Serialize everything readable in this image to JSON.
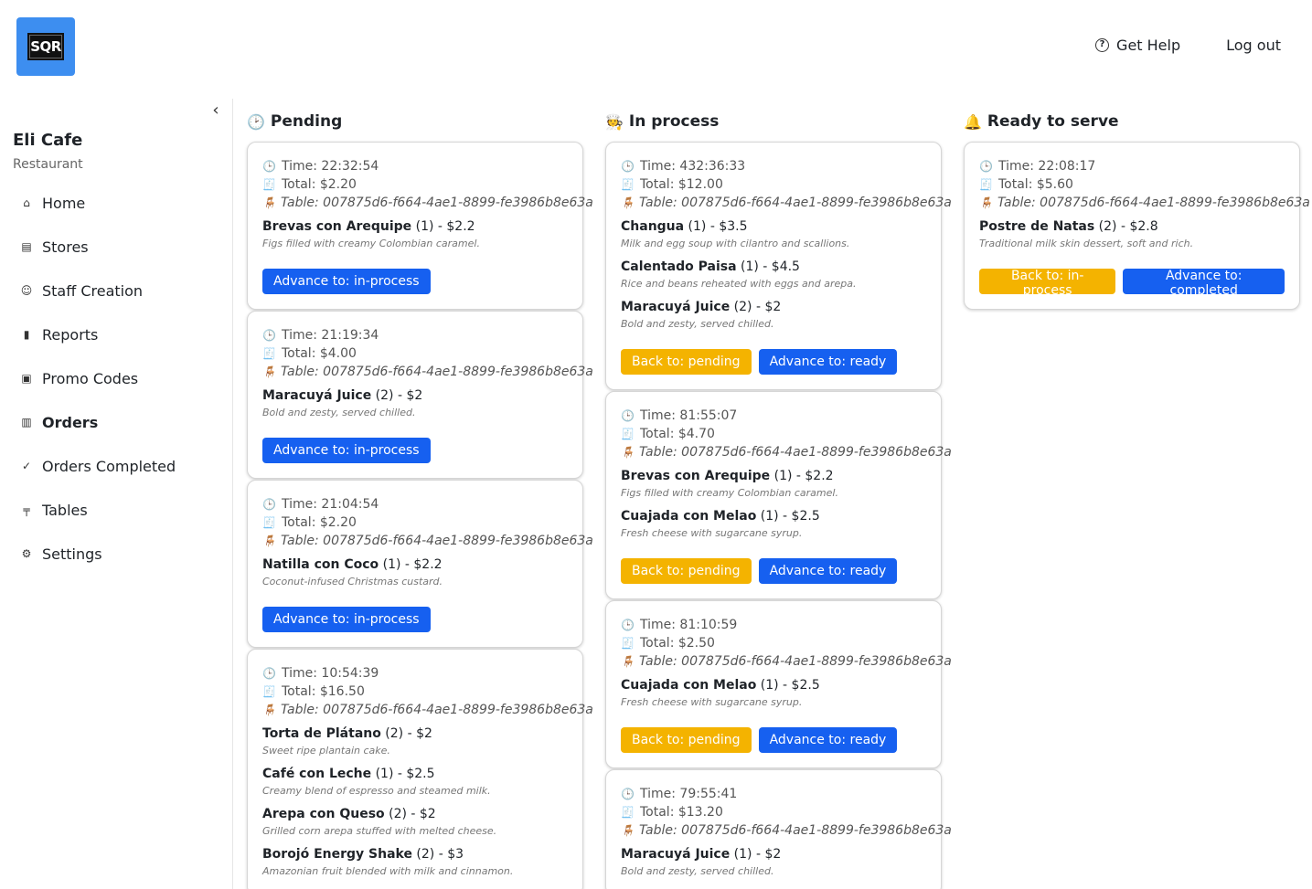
{
  "header": {
    "logo_text": "SQR",
    "help_label": "Get Help",
    "logout_label": "Log out"
  },
  "store": {
    "name": "Eli Cafe",
    "type": "Restaurant"
  },
  "menu": [
    {
      "label": "Home",
      "icon": "home-icon",
      "glyph": "⌂"
    },
    {
      "label": "Stores",
      "icon": "store-icon",
      "glyph": "▤"
    },
    {
      "label": "Staff Creation",
      "icon": "staff-icon",
      "glyph": "☺"
    },
    {
      "label": "Reports",
      "icon": "chart-icon",
      "glyph": "▮"
    },
    {
      "label": "Promo Codes",
      "icon": "ticket-icon",
      "glyph": "▣"
    },
    {
      "label": "Orders",
      "icon": "orders-icon",
      "glyph": "▥"
    },
    {
      "label": "Orders Completed",
      "icon": "check-circle-icon",
      "glyph": "✓"
    },
    {
      "label": "Tables",
      "icon": "table-icon",
      "glyph": "╤"
    },
    {
      "label": "Settings",
      "icon": "gear-icon",
      "glyph": "⚙"
    }
  ],
  "columns": [
    {
      "title": "Pending",
      "emoji": "🕑",
      "orders": [
        {
          "time": "Time: 22:32:54",
          "total": "Total: $2.20",
          "table": "Table: 007875d6-f664-4ae1-8899-fe3986b8e63a",
          "items": [
            {
              "name": "Brevas con Arequipe",
              "qty": " (1) - $2.2",
              "desc": "Figs filled with creamy Colombian caramel."
            }
          ],
          "buttons": [
            {
              "label": "Advance to: in-process",
              "style": "blue"
            }
          ]
        },
        {
          "time": "Time: 21:19:34",
          "total": "Total: $4.00",
          "table": "Table: 007875d6-f664-4ae1-8899-fe3986b8e63a",
          "items": [
            {
              "name": "Maracuyá Juice",
              "qty": " (2) - $2",
              "desc": "Bold and zesty, served chilled."
            }
          ],
          "buttons": [
            {
              "label": "Advance to: in-process",
              "style": "blue"
            }
          ]
        },
        {
          "time": "Time: 21:04:54",
          "total": "Total: $2.20",
          "table": "Table: 007875d6-f664-4ae1-8899-fe3986b8e63a",
          "items": [
            {
              "name": "Natilla con Coco",
              "qty": " (1) - $2.2",
              "desc": "Coconut-infused Christmas custard."
            }
          ],
          "buttons": [
            {
              "label": "Advance to: in-process",
              "style": "blue"
            }
          ]
        },
        {
          "time": "Time: 10:54:39",
          "total": "Total: $16.50",
          "table": "Table: 007875d6-f664-4ae1-8899-fe3986b8e63a",
          "items": [
            {
              "name": "Torta de Plátano",
              "qty": " (2) - $2",
              "desc": "Sweet ripe plantain cake."
            },
            {
              "name": "Café con Leche",
              "qty": " (1) - $2.5",
              "desc": "Creamy blend of espresso and steamed milk."
            },
            {
              "name": "Arepa con Queso",
              "qty": " (2) - $2",
              "desc": "Grilled corn arepa stuffed with melted cheese."
            },
            {
              "name": "Borojó Energy Shake",
              "qty": " (2) - $3",
              "desc": "Amazonian fruit blended with milk and cinnamon."
            }
          ],
          "buttons": []
        }
      ]
    },
    {
      "title": "In process",
      "emoji": "🧑‍🍳",
      "orders": [
        {
          "time": "Time: 432:36:33",
          "total": "Total: $12.00",
          "table": "Table: 007875d6-f664-4ae1-8899-fe3986b8e63a",
          "items": [
            {
              "name": "Changua",
              "qty": " (1) - $3.5",
              "desc": "Milk and egg soup with cilantro and scallions."
            },
            {
              "name": "Calentado Paisa",
              "qty": " (1) - $4.5",
              "desc": "Rice and beans reheated with eggs and arepa."
            },
            {
              "name": "Maracuyá Juice",
              "qty": " (2) - $2",
              "desc": "Bold and zesty, served chilled."
            }
          ],
          "buttons": [
            {
              "label": "Back to: pending",
              "style": "yellow"
            },
            {
              "label": "Advance to: ready",
              "style": "blue"
            }
          ]
        },
        {
          "time": "Time: 81:55:07",
          "total": "Total: $4.70",
          "table": "Table: 007875d6-f664-4ae1-8899-fe3986b8e63a",
          "items": [
            {
              "name": "Brevas con Arequipe",
              "qty": " (1) - $2.2",
              "desc": "Figs filled with creamy Colombian caramel."
            },
            {
              "name": "Cuajada con Melao",
              "qty": " (1) - $2.5",
              "desc": "Fresh cheese with sugarcane syrup."
            }
          ],
          "buttons": [
            {
              "label": "Back to: pending",
              "style": "yellow"
            },
            {
              "label": "Advance to: ready",
              "style": "blue"
            }
          ]
        },
        {
          "time": "Time: 81:10:59",
          "total": "Total: $2.50",
          "table": "Table: 007875d6-f664-4ae1-8899-fe3986b8e63a",
          "items": [
            {
              "name": "Cuajada con Melao",
              "qty": " (1) - $2.5",
              "desc": "Fresh cheese with sugarcane syrup."
            }
          ],
          "buttons": [
            {
              "label": "Back to: pending",
              "style": "yellow"
            },
            {
              "label": "Advance to: ready",
              "style": "blue"
            }
          ]
        },
        {
          "time": "Time: 79:55:41",
          "total": "Total: $13.20",
          "table": "Table: 007875d6-f664-4ae1-8899-fe3986b8e63a",
          "items": [
            {
              "name": "Maracuyá Juice",
              "qty": " (1) - $2",
              "desc": "Bold and zesty, served chilled."
            }
          ],
          "buttons": []
        }
      ]
    },
    {
      "title": "Ready to serve",
      "emoji": "🔔",
      "orders": [
        {
          "time": "Time: 22:08:17",
          "total": "Total: $5.60",
          "table": "Table: 007875d6-f664-4ae1-8899-fe3986b8e63a",
          "items": [
            {
              "name": "Postre de Natas",
              "qty": " (2) - $2.8",
              "desc": "Traditional milk skin dessert, soft and rich."
            }
          ],
          "buttons": [
            {
              "label": "Back to: in-process",
              "style": "yellow"
            },
            {
              "label": "Advance to: completed",
              "style": "blue"
            }
          ]
        }
      ]
    }
  ],
  "icons": {
    "time": "🕒",
    "total": "🧾",
    "table": "🪑"
  },
  "colors": {
    "primary_button": "#1660f0",
    "secondary_button": "#f4b300",
    "logo_bg": "#3d8ef0"
  }
}
